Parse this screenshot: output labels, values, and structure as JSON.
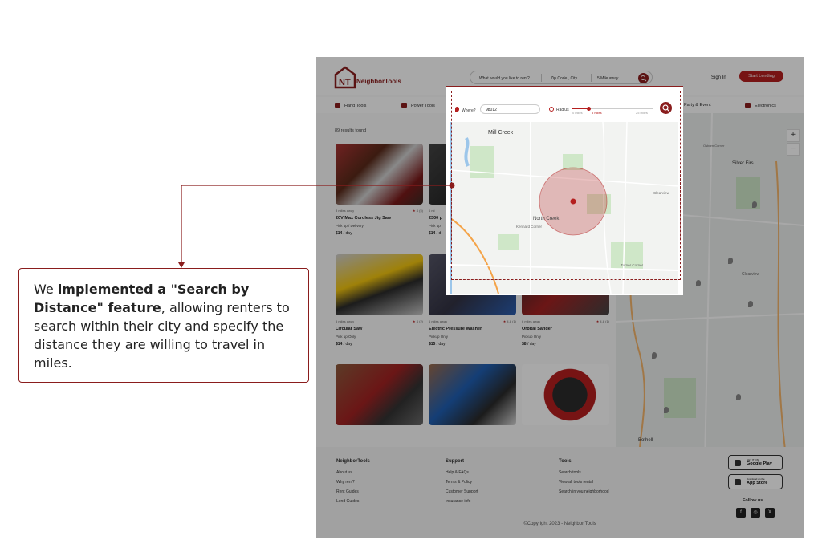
{
  "header": {
    "logo_text": "NeighborTools",
    "search_placeholder": "What would you like to rent?",
    "zip_label": "Zip Code , City",
    "distance_label": "5 Mile away",
    "signin": "Sign In",
    "start_lending": "Start Lending"
  },
  "categories": [
    "Hand Tools",
    "Power Tools",
    "Party & Event",
    "Electronics"
  ],
  "results_count": "89 results found",
  "listings": [
    {
      "distance": "3 miles away",
      "rating": "4",
      "reviews": "(5)",
      "title": "20V Max Cordless Jig Saw",
      "pickup": "Pick up / Delivery",
      "price": "$14",
      "unit": "/ day"
    },
    {
      "distance": "6 mi",
      "rating": "",
      "reviews": "",
      "title": "2300 p",
      "pickup": "Pick up",
      "price": "$14",
      "unit": "/ d"
    },
    {
      "distance": "5 miles away",
      "rating": "4",
      "reviews": "(2)",
      "title": "Circular Saw",
      "pickup": "Pick up Only",
      "price": "$14",
      "unit": "/ day"
    },
    {
      "distance": "6 miles away",
      "rating": "4.8",
      "reviews": "(1)",
      "title": "Electric Pressure Washer",
      "pickup": "Pickup Only",
      "price": "$15",
      "unit": "/ day"
    },
    {
      "distance": "6 miles away",
      "rating": "4.8",
      "reviews": "(1)",
      "title": "Orbital Sander",
      "pickup": "Pickup Only",
      "price": "$8",
      "unit": "/ day"
    }
  ],
  "popup": {
    "where_label": "Where?",
    "zip_value": "98012",
    "radius_label": "Radius",
    "min_label": "0 miles",
    "selected_label": "5 miles",
    "max_label": "25 miles",
    "radius_value_miles": 5,
    "radius_max_miles": 25
  },
  "map_labels": {
    "mill_creek": "Mill Creek",
    "north_creek": "North Creek",
    "kennard_corner": "Kennard Corner",
    "turner_corner": "Turner Corner",
    "clearview": "Clearview",
    "silver_firs": "Silver Firs",
    "bothell": "Bothell",
    "osborn_corner": "Osborn Corner",
    "zoom_in": "+",
    "zoom_out": "−"
  },
  "footer": {
    "col1_title": "NeighborTools",
    "col1_links": [
      "About us",
      "Why rent?",
      "Rent Guides",
      "Lend Guides"
    ],
    "col2_title": "Support",
    "col2_links": [
      "Help & FAQs",
      "Terms & Policy",
      "Customer Support",
      "Insurance info"
    ],
    "col3_title": "Tools",
    "col3_links": [
      "Search tools",
      "View all tools rental",
      "Search in you neighborhood"
    ],
    "google_small": "GET IT ON",
    "google_big": "Google Play",
    "apple_small": "Download on the",
    "apple_big": "App Store",
    "follow_us": "Follow us",
    "copyright": "©Copyright 2023 - Neighbor Tools"
  },
  "annotation": {
    "t1": "We ",
    "t2": "implemented a \"Search by Distance\" feature",
    "t3": ", allowing renters to search within their city and specify the distance they are willing to travel in miles."
  },
  "colors": {
    "brand": "#8a1d1d",
    "accent": "#b51f1f"
  }
}
